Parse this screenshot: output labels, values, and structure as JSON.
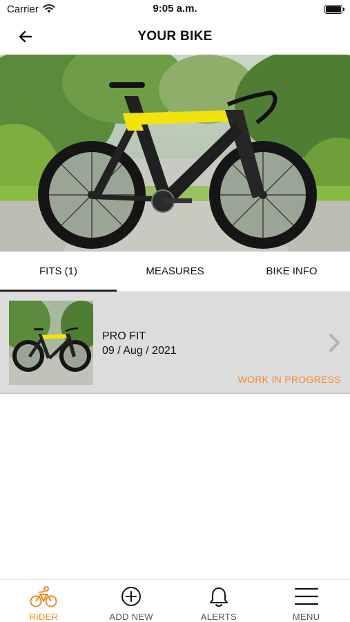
{
  "status_bar": {
    "carrier": "Carrier",
    "time": "9:05 a.m."
  },
  "header": {
    "title": "YOUR BIKE"
  },
  "tabs": [
    {
      "label": "FITS (1)",
      "active": true
    },
    {
      "label": "MEASURES",
      "active": false
    },
    {
      "label": "BIKE INFO",
      "active": false
    }
  ],
  "fits": [
    {
      "name": "PRO FIT",
      "date": "09 / Aug / 2021",
      "status": "WORK IN PROGRESS"
    }
  ],
  "bottom_nav": [
    {
      "label": "RIDER",
      "icon": "bicycle-icon",
      "active": true
    },
    {
      "label": "ADD NEW",
      "icon": "plus-circle-icon",
      "active": false
    },
    {
      "label": "ALERTS",
      "icon": "bell-icon",
      "active": false
    },
    {
      "label": "MENU",
      "icon": "hamburger-menu-icon",
      "active": false
    }
  ],
  "colors": {
    "accent": "#f28c28",
    "frame_yellow": "#f2e40b",
    "row_background": "#dcdcdc"
  }
}
